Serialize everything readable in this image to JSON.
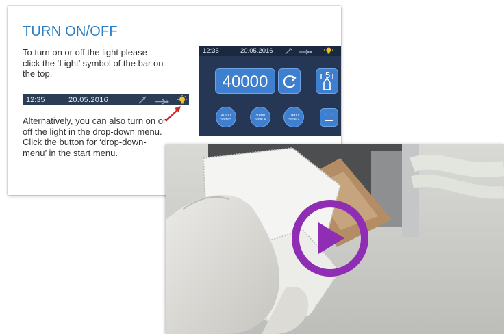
{
  "instruction": {
    "title": "TURN ON/OFF",
    "paragraph1": "To turn on or off the light please click the ‘Light’ symbol of the bar on the top.",
    "paragraph2": "Alternatively, you can also turn on or off the light in the drop-down menu. Click the button for ‘drop-down-menu’ in the start menu."
  },
  "status_bar": {
    "time": "12:35",
    "date": "20.05.2016",
    "icons": [
      "wrench-icon",
      "usb-icon",
      "light-bulb-icon"
    ],
    "light_color": "#f2c12e"
  },
  "device_screen": {
    "time": "12:35",
    "date": "20.05.2016",
    "speed": "40000",
    "stage_number": "5",
    "presets": [
      {
        "value": "40000",
        "label": "Stufe 5"
      },
      {
        "value": "30000",
        "label": "Stufe 4"
      },
      {
        "value": "10000",
        "label": "Stufe 2"
      }
    ]
  },
  "video": {
    "play_color": "#8f2db4",
    "icon": "play-icon"
  },
  "colors": {
    "title": "#2f7fc4",
    "arrow": "#d3272a",
    "device_bg": "#253755",
    "button": "#3f7fd0"
  }
}
